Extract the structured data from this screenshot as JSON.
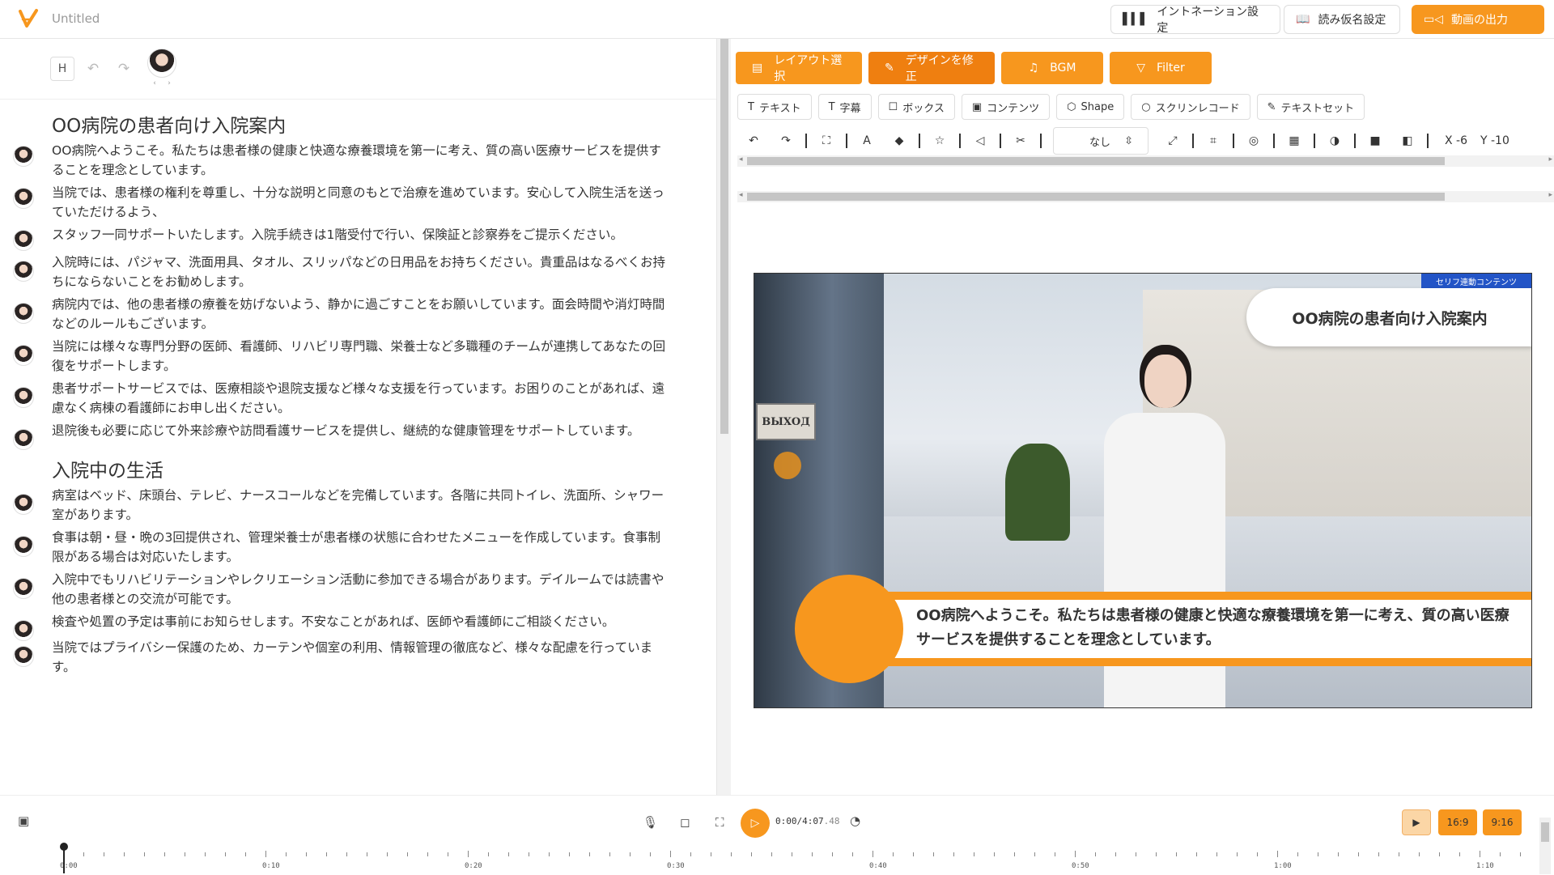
{
  "app": {
    "title": "Untitled",
    "accent": "#f7971e"
  },
  "header": {
    "intonation_label": "イントネーション設定",
    "reading_label": "読み仮名設定",
    "export_label": "動画の出力"
  },
  "editor": {
    "heading_button": "H",
    "blocks": [
      {
        "type": "heading",
        "text": "OO病院の患者向け入院案内"
      },
      {
        "type": "para",
        "text": "OO病院へようこそ。私たちは患者様の健康と快適な療養環境を第一に考え、質の高い医療サービスを提供することを理念としています。"
      },
      {
        "type": "para",
        "text": "当院では、患者様の権利を尊重し、十分な説明と同意のもとで治療を進めています。安心して入院生活を送っていただけるよう、"
      },
      {
        "type": "para",
        "text": "スタッフ一同サポートいたします。入院手続きは1階受付で行い、保険証と診察券をご提示ください。"
      },
      {
        "type": "para",
        "text": "入院時には、パジャマ、洗面用具、タオル、スリッパなどの日用品をお持ちください。貴重品はなるべくお持ちにならないことをお勧めします。"
      },
      {
        "type": "para",
        "text": "病院内では、他の患者様の療養を妨げないよう、静かに過ごすことをお願いしています。面会時間や消灯時間などのルールもございます。"
      },
      {
        "type": "para",
        "text": "当院には様々な専門分野の医師、看護師、リハビリ専門職、栄養士など多職種のチームが連携してあなたの回復をサポートします。"
      },
      {
        "type": "para",
        "text": "患者サポートサービスでは、医療相談や退院支援など様々な支援を行っています。お困りのことがあれば、遠慮なく病棟の看護師にお申し出ください。"
      },
      {
        "type": "para",
        "text": "退院後も必要に応じて外来診療や訪問看護サービスを提供し、継続的な健康管理をサポートしています。"
      },
      {
        "type": "heading",
        "text": "入院中の生活"
      },
      {
        "type": "para",
        "text": "病室はベッド、床頭台、テレビ、ナースコールなどを完備しています。各階に共同トイレ、洗面所、シャワー室があります。"
      },
      {
        "type": "para",
        "text": "食事は朝・昼・晩の3回提供され、管理栄養士が患者様の状態に合わせたメニューを作成しています。食事制限がある場合は対応いたします。"
      },
      {
        "type": "para",
        "text": "入院中でもリハビリテーションやレクリエーション活動に参加できる場合があります。デイルームでは読書や他の患者様との交流が可能です。"
      },
      {
        "type": "para",
        "text": "検査や処置の予定は事前にお知らせします。不安なことがあれば、医師や看護師にご相談ください。"
      },
      {
        "type": "para",
        "text": "当院ではプライバシー保護のため、カーテンや個室の利用、情報管理の徹底など、様々な配慮を行っています。"
      }
    ]
  },
  "tabs": [
    {
      "label": "レイアウト選択",
      "icon": "layout-icon"
    },
    {
      "label": "デザインを修正",
      "icon": "pencil-icon"
    },
    {
      "label": "BGM",
      "icon": "music-icon"
    },
    {
      "label": "Filter",
      "icon": "filter-icon"
    }
  ],
  "elements": [
    {
      "label": "テキスト",
      "icon": "T"
    },
    {
      "label": "字幕",
      "icon": "T"
    },
    {
      "label": "ボックス",
      "icon": "☐"
    },
    {
      "label": "コンテンツ",
      "icon": "▣"
    },
    {
      "label": "Shape",
      "icon": "⬡"
    },
    {
      "label": "スクリンレコード",
      "icon": "○"
    },
    {
      "label": "テキストセット",
      "icon": "✎"
    }
  ],
  "toolbar": {
    "font_select_value": "なし",
    "x_label": "X -6",
    "y_label": "Y -10"
  },
  "preview": {
    "badge": "セリフ連動コンテンツ",
    "title": "OO病院の患者向け入院案内",
    "caption": "OO病院へようこそ。私たちは患者様の健康と快適な療養環境を第一に考え、質の高い医療サービスを提供することを理念としています。",
    "exit_sign": "ВЫХОД"
  },
  "timeline": {
    "time_current": "0:00",
    "time_total": "/4:07",
    "time_ms": ".48",
    "aspect_169": "16:9",
    "aspect_916": "9:16",
    "ruler_labels": [
      "0:00",
      "0:10",
      "0:20",
      "0:30",
      "0:40",
      "0:50",
      "1:00",
      "1:10"
    ]
  }
}
